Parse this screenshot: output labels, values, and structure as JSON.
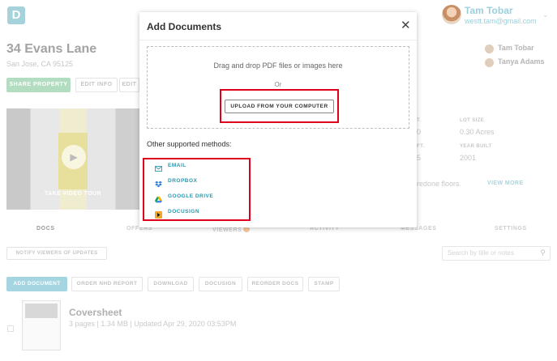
{
  "app": {
    "logo_letter": "D"
  },
  "profile": {
    "name": "Tam Tobar",
    "email": "westt.tam@gmail.com",
    "chevron": "⌄"
  },
  "property": {
    "title": "34 Evans Lane",
    "address": "San Jose, CA 95125",
    "share_label": "SHARE PROPERTY",
    "edit_info_label": "EDIT INFO",
    "edit_label": "EDIT",
    "video_caption": "TAKE VIDEO TOUR",
    "play_glyph": "▶"
  },
  "shared_with": [
    "Tam Tobar",
    "Tanya Adams"
  ],
  "specs": {
    "col1_labels": [
      "T.",
      "FT."
    ],
    "col1_values": [
      "0",
      "5"
    ],
    "lot_size_label": "LOT SIZE",
    "lot_size_value": "0.30 Acres",
    "year_built_label": "YEAR BUILT",
    "year_built_value": "2001",
    "snippet": "redone floors.",
    "view_more": "VIEW MORE"
  },
  "tabs": [
    {
      "label": "DOCS",
      "active": true
    },
    {
      "label": "OFFERS"
    },
    {
      "label": "VIEWERS"
    },
    {
      "label": "ACTIVITY"
    },
    {
      "label": "MESSAGES"
    },
    {
      "label": "SETTINGS"
    }
  ],
  "toolbar": {
    "notify_label": "NOTIFY VIEWERS OF UPDATES",
    "search_placeholder": "Search by title or notes",
    "search_glyph": "⚲"
  },
  "actions": [
    "ADD DOCUMENT",
    "ORDER NHD REPORT",
    "DOWNLOAD",
    "DOCUSIGN",
    "REORDER DOCS",
    "STAMP"
  ],
  "document": {
    "title": "Coversheet",
    "meta": "3 pages | 1.34 MB | Updated Apr 29, 2020 03:53PM"
  },
  "modal": {
    "title": "Add Documents",
    "close_glyph": "✕",
    "drop_text": "Drag and drop PDF files or images here",
    "or_text": "Or",
    "upload_label": "UPLOAD FROM YOUR COMPUTER",
    "other_methods_label": "Other supported methods:",
    "methods": [
      {
        "label": "EMAIL",
        "icon": "email-icon"
      },
      {
        "label": "DROPBOX",
        "icon": "dropbox-icon"
      },
      {
        "label": "GOOGLE DRIVE",
        "icon": "google-drive-icon"
      },
      {
        "label": "DOCUSIGN",
        "icon": "docusign-icon"
      }
    ]
  },
  "colors": {
    "accent": "#2b97ad",
    "highlight": "#e0001b",
    "primary_button": "#a4d5e0",
    "share_button": "#b3ddc0"
  }
}
